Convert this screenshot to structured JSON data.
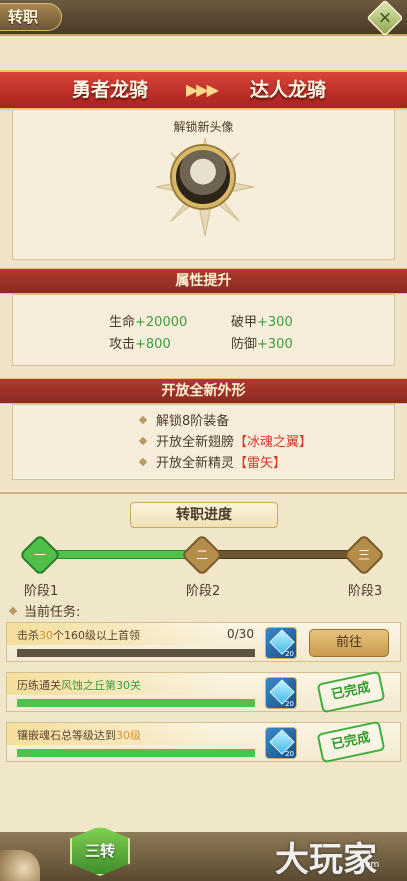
{
  "header": {
    "title": "转职"
  },
  "class_change": {
    "from": "勇者龙骑",
    "arrows": "▶▶▶",
    "to": "达人龙骑"
  },
  "avatar_section": {
    "unlock_text": "解锁新头像"
  },
  "attributes": {
    "title": "属性提升",
    "items": [
      {
        "label": "生命",
        "value": "+20000"
      },
      {
        "label": "破甲",
        "value": "+300"
      },
      {
        "label": "攻击",
        "value": "+800"
      },
      {
        "label": "防御",
        "value": "+300"
      }
    ]
  },
  "appearance": {
    "title": "开放全新外形",
    "items": [
      {
        "text": "解锁8阶装备",
        "highlight": ""
      },
      {
        "text": "开放全新翅膀",
        "highlight": "【冰魂之翼】"
      },
      {
        "text": "开放全新精灵",
        "highlight": "【雷矢】"
      }
    ]
  },
  "progress": {
    "title": "转职进度",
    "nodes": [
      "一",
      "二",
      "三"
    ],
    "stages": [
      "阶段1",
      "阶段2",
      "阶段3"
    ],
    "current_tasks_label": "当前任务:"
  },
  "tasks": [
    {
      "prefix": "击杀",
      "num": "30",
      "suffix": "个160级以上首领",
      "count": "0/30",
      "reward_qty": "20",
      "action": "前往",
      "progress": 0
    },
    {
      "prefix": "历练通关",
      "num": "风蚀之丘第30关",
      "suffix": "",
      "count": "",
      "reward_qty": "20",
      "action": "已完成",
      "progress": 1
    },
    {
      "prefix": "镶嵌魂石总等级达到",
      "num": "30级",
      "suffix": "",
      "count": "",
      "reward_qty": "20",
      "action": "已完成",
      "progress": 1
    }
  ],
  "footer": {
    "stage_button": "三转",
    "watermark": "大玩家",
    "watermark_sub": "com"
  },
  "colors": {
    "accent_red": "#b03a2d",
    "done_green": "#4fc24b",
    "highlight_red": "#d9362b"
  }
}
